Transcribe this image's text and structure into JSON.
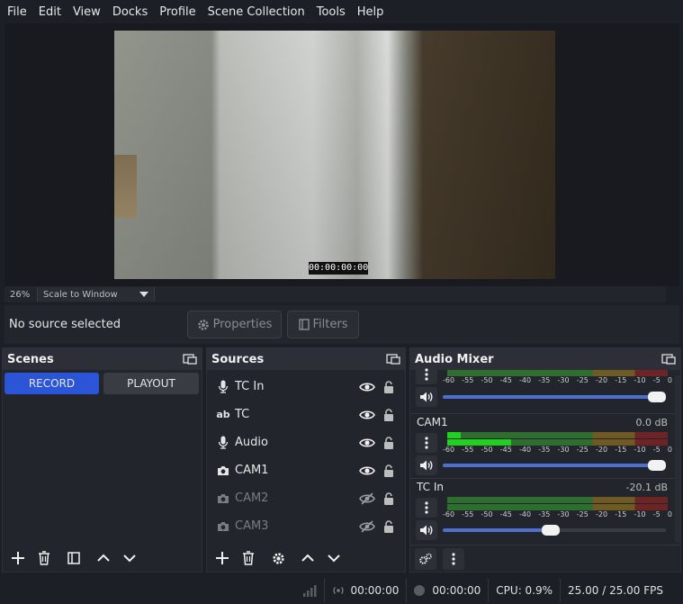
{
  "menu": [
    "File",
    "Edit",
    "View",
    "Docks",
    "Profile",
    "Scene Collection",
    "Tools",
    "Help"
  ],
  "preview": {
    "timecode": "00:00:00:00"
  },
  "zoom": {
    "percent": "26%",
    "mode": "Scale to Window"
  },
  "context": {
    "no_source": "No source selected",
    "properties": "Properties",
    "filters": "Filters"
  },
  "scenes": {
    "title": "Scenes",
    "items": [
      "RECORD",
      "PLAYOUT"
    ],
    "active": "RECORD"
  },
  "sources": {
    "title": "Sources",
    "items": [
      {
        "label": "TC In",
        "icon": "microphone-icon",
        "visible": true
      },
      {
        "label": "TC",
        "icon": "text-icon",
        "visible": true
      },
      {
        "label": "Audio",
        "icon": "microphone-icon",
        "visible": true
      },
      {
        "label": "CAM1",
        "icon": "camera-icon",
        "visible": true
      },
      {
        "label": "CAM2",
        "icon": "camera-icon",
        "visible": false
      },
      {
        "label": "CAM3",
        "icon": "camera-icon",
        "visible": false
      }
    ]
  },
  "mixer": {
    "title": "Audio Mixer",
    "scale": [
      "-60",
      "-55",
      "-50",
      "-45",
      "-40",
      "-35",
      "-30",
      "-25",
      "-20",
      "-15",
      "-10",
      "-5",
      "0"
    ],
    "channels": [
      {
        "name": "",
        "db": "",
        "level": 0.0,
        "volume": 1.0
      },
      {
        "name": "CAM1",
        "db": "0.0 dB",
        "level": 0.29,
        "volume": 1.0
      },
      {
        "name": "TC In",
        "db": "-20.1 dB",
        "level": 0.0,
        "volume": 0.48
      }
    ]
  },
  "status": {
    "stream_time": "00:00:00",
    "rec_time": "00:00:00",
    "cpu": "CPU: 0.9%",
    "fps": "25.00 / 25.00 FPS"
  },
  "colors": {
    "active_scene": "#2b55d6",
    "volume_fill": "#4f6fd0",
    "meter_green": "#22d022"
  }
}
